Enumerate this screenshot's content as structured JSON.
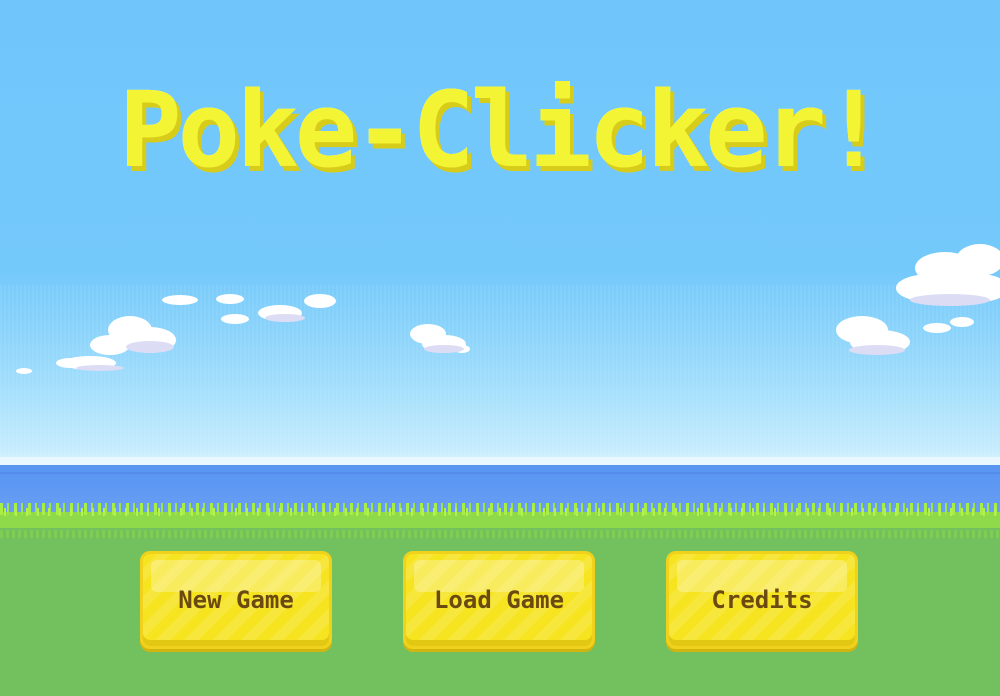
{
  "game": {
    "title": "Poke-Clicker!"
  },
  "menu": {
    "new_game": "New Game",
    "load_game": "Load Game",
    "credits": "Credits"
  },
  "colors": {
    "title_fill": "#f3f534",
    "title_shadow": "#d7cc1a",
    "button_fill": "#f6e421",
    "button_text": "#6b4a12",
    "sky": "#70c6fb",
    "sea": "#5a95f2",
    "grass": "#72c15e"
  }
}
